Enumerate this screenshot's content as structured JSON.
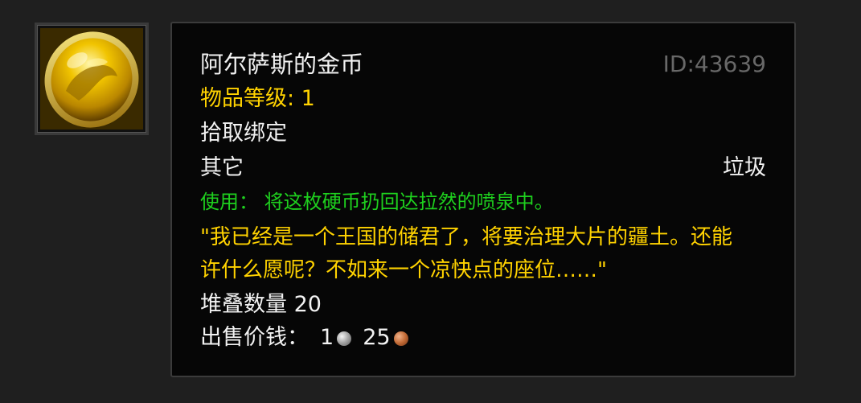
{
  "item": {
    "name": "阿尔萨斯的金币",
    "id_label": "ID:43639",
    "item_level": "物品等级: 1",
    "bind": "拾取绑定",
    "category": "其它",
    "quality": "垃圾",
    "use_text": "使用： 将这枚硬币扔回达拉然的喷泉中。",
    "flavor_line1": "\"我已经是一个王国的储君了，将要治理大片的疆土。还能",
    "flavor_line2": "许什么愿呢？不如来一个凉快点的座位……\"",
    "stack": "堆叠数量 20",
    "sell_label": "出售价钱：",
    "sell_silver": "1",
    "sell_copper": "25"
  },
  "icon": {
    "name": "gold-coin-icon",
    "color": "#e0b000"
  },
  "colors": {
    "white": "#f2f2f2",
    "yellow": "#ffd200",
    "green": "#1ed01e",
    "gray": "#686868",
    "background": "#1f1f1f",
    "tooltip_bg": "#060606"
  }
}
